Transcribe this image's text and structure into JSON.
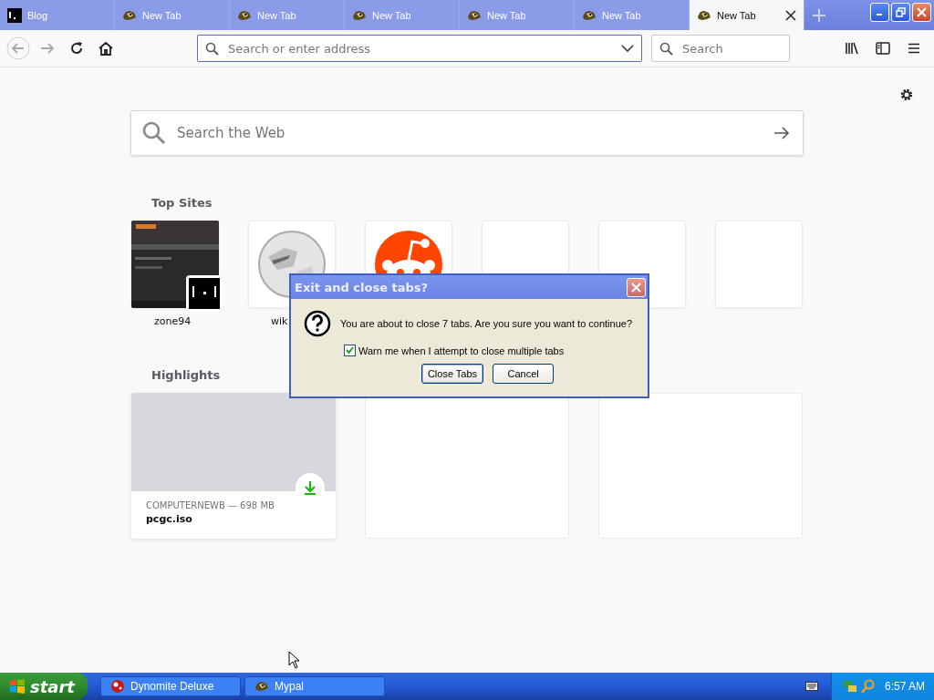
{
  "tabs": [
    {
      "title": "Blog",
      "kind": "blog",
      "selected": false
    },
    {
      "title": "New Tab",
      "kind": "mypal",
      "selected": false
    },
    {
      "title": "New Tab",
      "kind": "mypal",
      "selected": false
    },
    {
      "title": "New Tab",
      "kind": "mypal",
      "selected": false
    },
    {
      "title": "New Tab",
      "kind": "mypal",
      "selected": false
    },
    {
      "title": "New Tab",
      "kind": "mypal",
      "selected": false
    },
    {
      "title": "New Tab",
      "kind": "mypal",
      "selected": true
    }
  ],
  "toolbar": {
    "address": {
      "placeholder": "Search or enter address"
    },
    "search": {
      "placeholder": "Search"
    }
  },
  "page": {
    "search": {
      "placeholder": "Search the Web"
    },
    "top_sites": {
      "heading": "Top Sites",
      "sites": [
        {
          "kind": "zone94",
          "label": "zone94"
        },
        {
          "kind": "wikipedia",
          "label": "wik"
        },
        {
          "kind": "reddit"
        },
        {
          "kind": "empty"
        },
        {
          "kind": "empty"
        },
        {
          "kind": "empty"
        }
      ]
    },
    "highlights": {
      "heading": "Highlights",
      "cards": [
        {
          "kind": "download",
          "source": "COMPUTERNEWB — 698 MB",
          "title": "pcgc.iso"
        },
        {
          "kind": "empty"
        },
        {
          "kind": "empty"
        }
      ]
    }
  },
  "dialog": {
    "title": "Exit and close tabs?",
    "message": "You are about to close 7 tabs. Are you sure you want to continue?",
    "checkbox": {
      "label": "Warn me when I attempt to close multiple tabs",
      "checked": true
    },
    "buttons": [
      {
        "label": "Close Tabs",
        "selected": true
      },
      {
        "label": "Cancel",
        "selected": false
      }
    ]
  },
  "taskbar": {
    "start": "start",
    "tasks": [
      {
        "kind": "dynomite",
        "label": "Dynomite Deluxe"
      },
      {
        "kind": "mypal",
        "label": "Mypal"
      }
    ],
    "clock": "6:57 AM"
  }
}
